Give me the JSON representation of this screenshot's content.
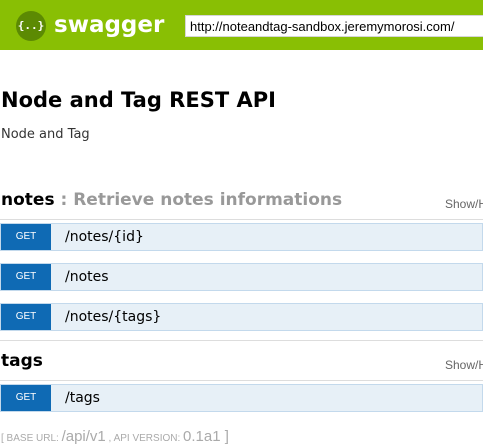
{
  "header": {
    "logo_icon_text": "{..}",
    "logo_text": "swagger",
    "url_value": "http://noteandtag-sandbox.jeremymorosi.com/"
  },
  "api": {
    "title": "Node and Tag REST API",
    "description": "Node and Tag"
  },
  "resources": [
    {
      "name": "notes",
      "description": " : Retrieve notes informations",
      "toggle": "Show/Hide",
      "operations": [
        {
          "method": "GET",
          "path": "/notes/{id}"
        },
        {
          "method": "GET",
          "path": "/notes"
        },
        {
          "method": "GET",
          "path": "/notes/{tags}"
        }
      ]
    },
    {
      "name": "tags",
      "description": "",
      "toggle": "Show/Hide",
      "operations": [
        {
          "method": "GET",
          "path": "/tags"
        }
      ]
    }
  ],
  "footer": {
    "base_url_label": "[ BASE URL: ",
    "base_url_value": "/api/v1",
    "version_label": " , API VERSION: ",
    "version_value": "0.1a1",
    "close": " ]"
  },
  "colors": {
    "topbar": "#89bf04",
    "get_method": "#0f6ab4",
    "operation_bg": "#e7f0f7"
  }
}
